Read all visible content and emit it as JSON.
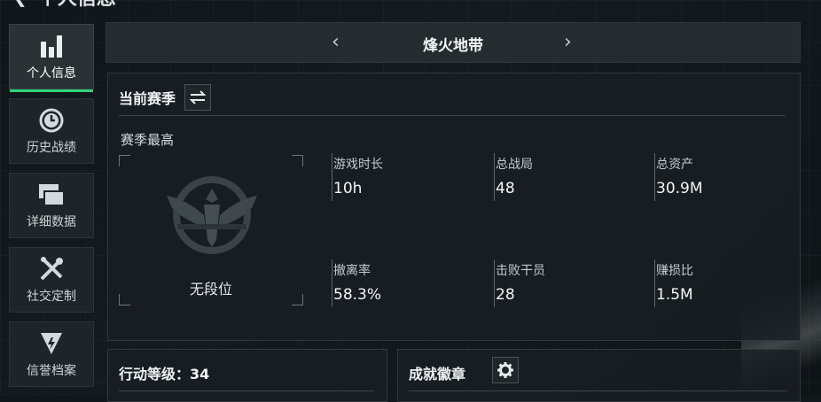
{
  "header": {
    "back_icon": "chevron-left-icon",
    "title": "个人信息"
  },
  "sidebar": {
    "items": [
      {
        "label": "个人信息",
        "icon": "bar-chart-icon",
        "active": true
      },
      {
        "label": "历史战绩",
        "icon": "clock-history-icon",
        "active": false
      },
      {
        "label": "详细数据",
        "icon": "cards-icon",
        "active": false
      },
      {
        "label": "社交定制",
        "icon": "tools-icon",
        "active": false
      },
      {
        "label": "信誉档案",
        "icon": "shield-badge-icon",
        "active": false
      }
    ],
    "accent": "#2fd47a"
  },
  "mode_selector": {
    "name": "烽火地带",
    "prev_icon": "chevron-left-icon",
    "next_icon": "chevron-right-icon"
  },
  "season_panel": {
    "title": "当前赛季",
    "swap_icon": "swap-icon",
    "best_title": "赛季最高",
    "rank_label": "无段位",
    "emblem_icon": "eagle-emblem-icon",
    "stats": [
      {
        "key": "游戏时长",
        "value": "10h"
      },
      {
        "key": "总战局",
        "value": "48"
      },
      {
        "key": "总资产",
        "value": "30.9M"
      },
      {
        "key": "撤离率",
        "value": "58.3%"
      },
      {
        "key": "击败干员",
        "value": "28"
      },
      {
        "key": "赚损比",
        "value": "1.5M"
      }
    ]
  },
  "action_level": {
    "label": "行动等级：34"
  },
  "achievements": {
    "title": "成就徽章",
    "settings_icon": "gear-icon"
  }
}
